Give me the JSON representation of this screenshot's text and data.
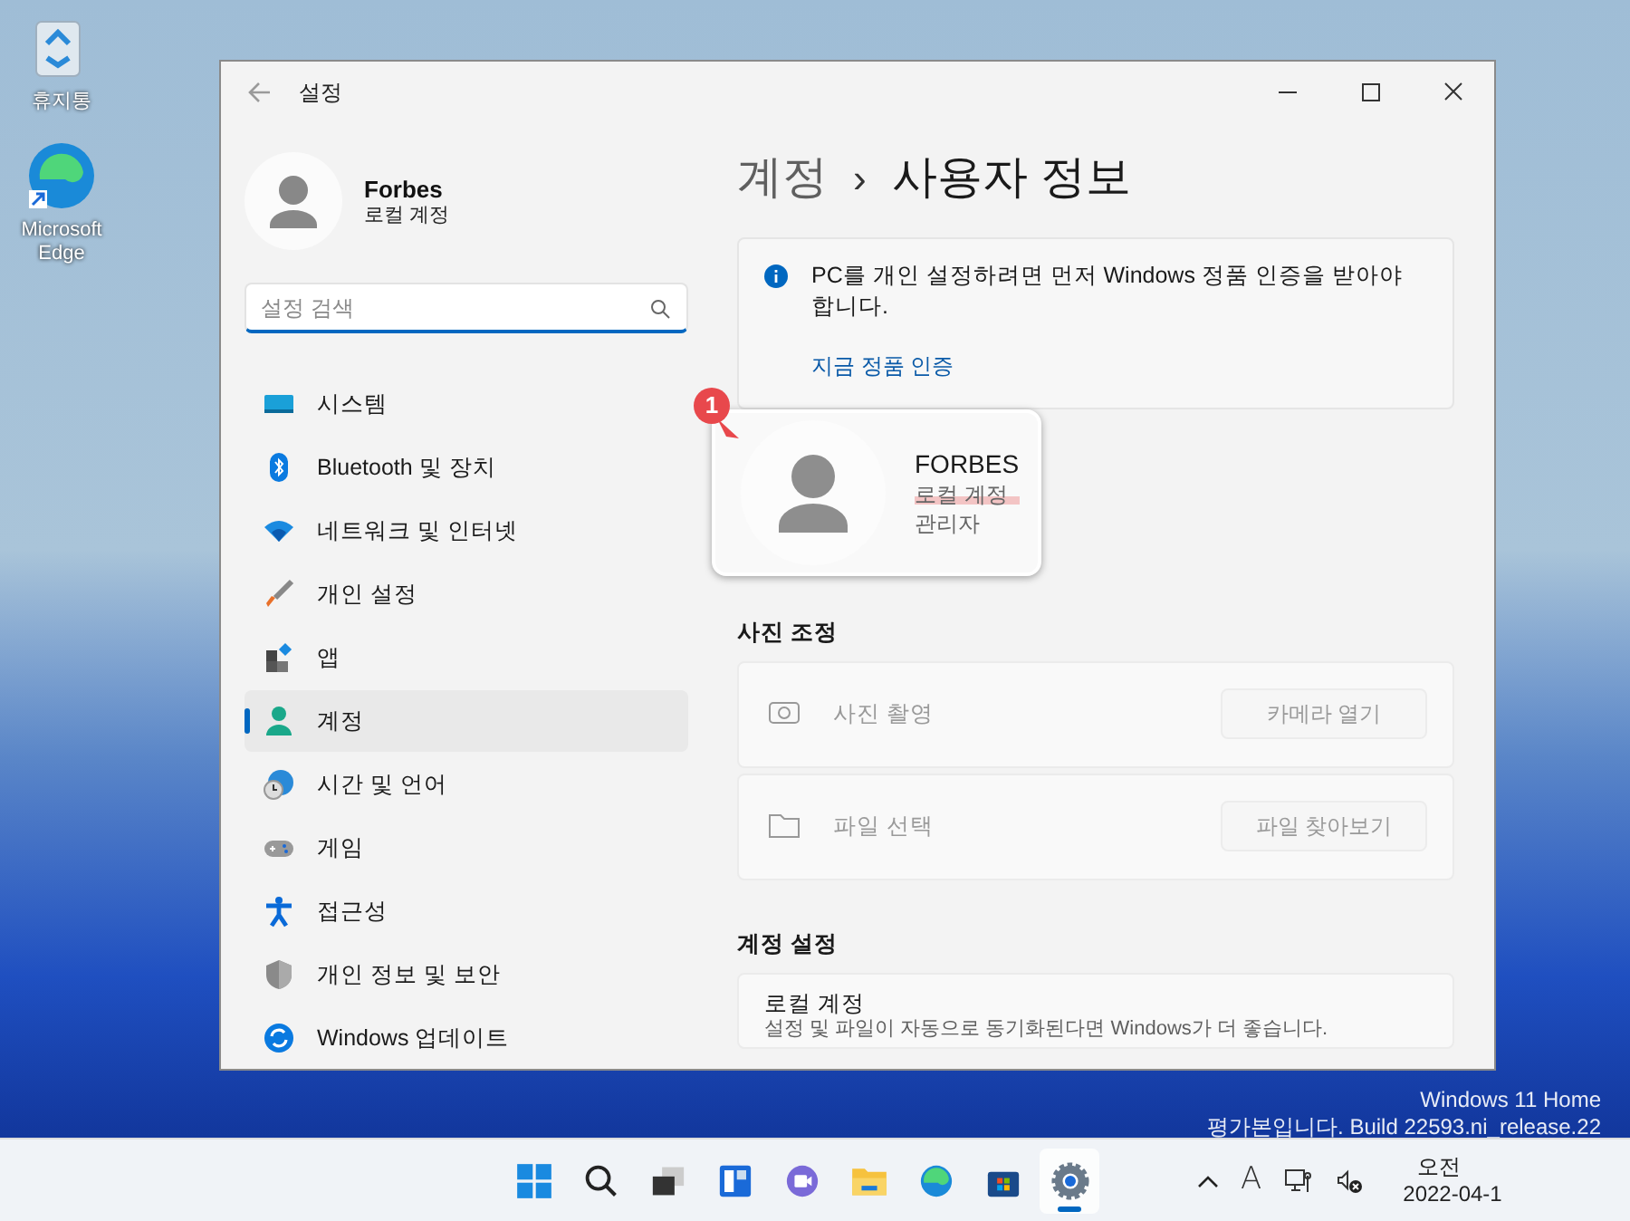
{
  "desktop": {
    "icons": [
      {
        "label": "휴지통"
      },
      {
        "label": "Microsoft Edge"
      }
    ],
    "watermark_lines": [
      "Windows 11 Home",
      "평가본입니다. Build 22593.ni_release.22"
    ]
  },
  "window": {
    "title": "설정",
    "profile": {
      "name": "Forbes",
      "account_type": "로컬 계정"
    },
    "search": {
      "placeholder": "설정 검색"
    },
    "nav": [
      {
        "label": "시스템",
        "selected": false
      },
      {
        "label": "Bluetooth 및 장치",
        "selected": false
      },
      {
        "label": "네트워크 및 인터넷",
        "selected": false
      },
      {
        "label": "개인 설정",
        "selected": false
      },
      {
        "label": "앱",
        "selected": false
      },
      {
        "label": "계정",
        "selected": true
      },
      {
        "label": "시간 및 언어",
        "selected": false
      },
      {
        "label": "게임",
        "selected": false
      },
      {
        "label": "접근성",
        "selected": false
      },
      {
        "label": "개인 정보 및 보안",
        "selected": false
      },
      {
        "label": "Windows 업데이트",
        "selected": false
      }
    ],
    "breadcrumb": {
      "parent": "계정",
      "separator": "›",
      "current": "사용자 정보"
    },
    "notice": {
      "text": "PC를 개인 설정하려면 먼저 Windows 정품 인증을 받아야 합니다.",
      "link": "지금 정품 인증"
    },
    "user_card": {
      "marker": "1",
      "name": "FORBES",
      "account_type": "로컬 계정",
      "role": "관리자"
    },
    "sections": [
      {
        "title": "사진 조정",
        "rows": [
          {
            "kind": "action",
            "label": "사진 촬영",
            "button": "카메라 열기",
            "disabled": true
          },
          {
            "kind": "action",
            "label": "파일 선택",
            "button": "파일 찾아보기",
            "disabled": true
          }
        ]
      },
      {
        "title": "계정 설정",
        "rows": [
          {
            "kind": "info",
            "label": "로컬 계정",
            "description": "설정 및 파일이 자동으로 동기화된다면 Windows가 더 좋습니다."
          }
        ]
      }
    ]
  },
  "taskbar": {
    "apps": [
      {
        "selected": false
      },
      {
        "selected": false
      },
      {
        "selected": false
      },
      {
        "selected": false
      },
      {
        "selected": false
      },
      {
        "selected": false
      },
      {
        "selected": false
      },
      {
        "selected": false
      },
      {
        "selected": true
      }
    ],
    "tray": {
      "ime": "A",
      "time": "오전",
      "date": "2022-04-1"
    }
  }
}
